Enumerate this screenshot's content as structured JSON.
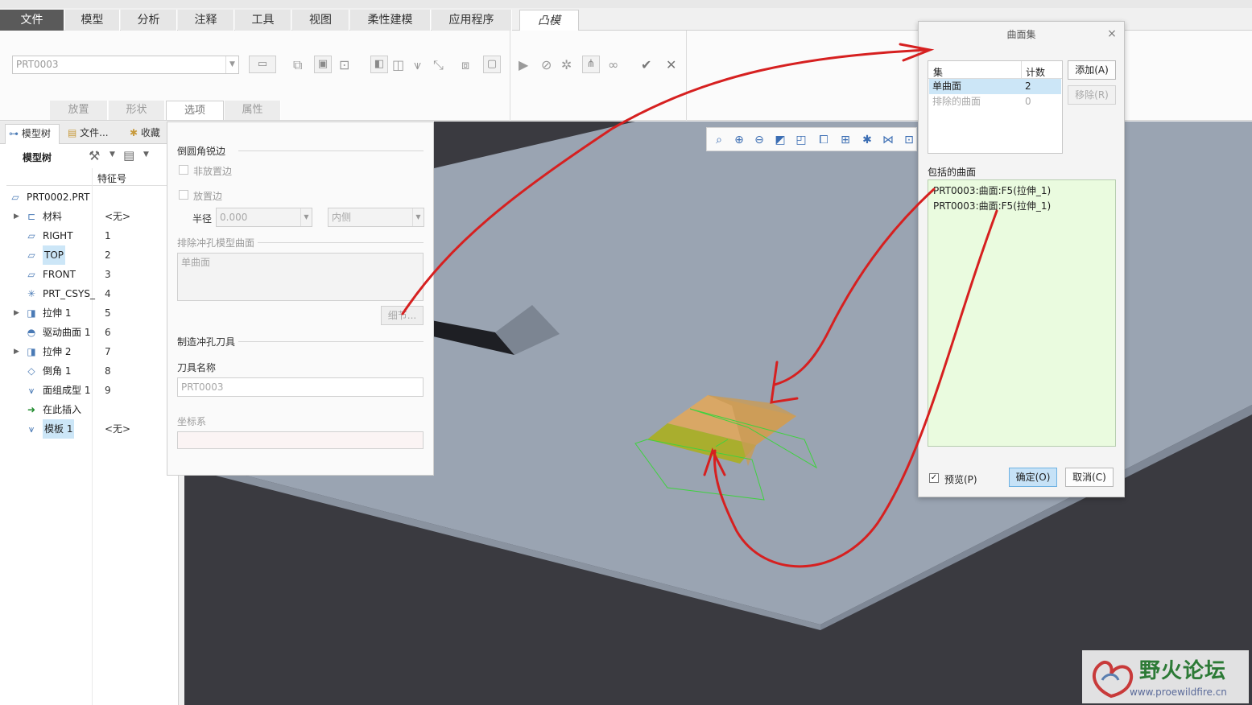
{
  "ribbon": {
    "tabs": [
      "文件",
      "模型",
      "分析",
      "注释",
      "工具",
      "视图",
      "柔性建模",
      "应用程序",
      "凸模"
    ],
    "active_tab": "凸模",
    "part_combo_value": "PRT0003",
    "subtabs": [
      "放置",
      "形状",
      "选项",
      "属性"
    ],
    "active_subtab": "选项"
  },
  "left_panel": {
    "tabs": [
      "模型树",
      "文件...",
      "收藏"
    ],
    "toolbar_label": "模型树",
    "column_header": "特征号",
    "root": "PRT0002.PRT",
    "rows": [
      {
        "name": "材料",
        "num": "<无>",
        "icon": "material-icon",
        "expandable": true
      },
      {
        "name": "RIGHT",
        "num": "1",
        "icon": "datum-plane-icon",
        "expandable": false
      },
      {
        "name": "TOP",
        "num": "2",
        "icon": "datum-plane-icon",
        "expandable": false,
        "highlight": true
      },
      {
        "name": "FRONT",
        "num": "3",
        "icon": "datum-plane-icon",
        "expandable": false
      },
      {
        "name": "PRT_CSYS_",
        "num": "4",
        "icon": "csys-icon",
        "expandable": false
      },
      {
        "name": "拉伸 1",
        "num": "5",
        "icon": "extrude-icon",
        "expandable": true
      },
      {
        "name": "驱动曲面 1",
        "num": "6",
        "icon": "drive-surface-icon",
        "expandable": false
      },
      {
        "name": "拉伸 2",
        "num": "7",
        "icon": "extrude-icon",
        "expandable": true
      },
      {
        "name": "倒角 1",
        "num": "8",
        "icon": "chamfer-icon",
        "expandable": false
      },
      {
        "name": "面组成型 1",
        "num": "9",
        "icon": "quilt-form-icon",
        "expandable": false
      },
      {
        "name": "在此插入",
        "num": "",
        "icon": "insert-here-icon",
        "expandable": false
      },
      {
        "name": "模板 1",
        "num": "<无>",
        "icon": "punch-form-icon",
        "expandable": false,
        "highlight": true
      }
    ]
  },
  "options_panel": {
    "round_sharp_edges": "倒圆角锐边",
    "non_placement_edges": "非放置边",
    "placement_edges": "放置边",
    "radius_label": "半径",
    "radius_value": "0.000",
    "side_value": "内侧",
    "exclude_surfaces": "排除冲孔模型曲面",
    "exclude_placeholder": "单曲面",
    "details_button": "细节...",
    "make_punch_tool": "制造冲孔刀具",
    "tool_name_label": "刀具名称",
    "tool_name_value": "PRT0003",
    "csys_label": "坐标系"
  },
  "dialog": {
    "title": "曲面集",
    "close": "×",
    "col_set": "集",
    "col_count": "计数",
    "rows": [
      {
        "name": "单曲面",
        "count": "2",
        "selected": true
      },
      {
        "name": "排除的曲面",
        "count": "0",
        "selected": false
      }
    ],
    "add_button": "添加(A)",
    "remove_button": "移除(R)",
    "included_label": "包括的曲面",
    "included_items": [
      "PRT0003:曲面:F5(拉伸_1)",
      "PRT0003:曲面:F5(拉伸_1)"
    ],
    "preview_label": "预览(P)",
    "preview_checked": true,
    "ok_button": "确定(O)",
    "cancel_button": "取消(C)"
  },
  "watermark": {
    "title": "野火论坛",
    "url": "www.proewildfire.cn"
  },
  "colors": {
    "selection_blue": "#cce6f7",
    "included_bg": "#eafbdf",
    "annotation_red": "#d62020",
    "plate": "#9aa4b2",
    "background": "#3a3a40"
  }
}
